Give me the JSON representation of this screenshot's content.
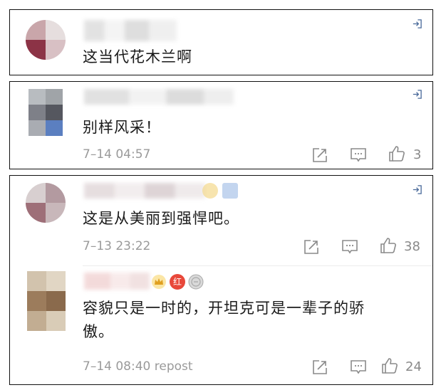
{
  "comments": [
    {
      "text": "这当代花木兰啊",
      "timestamp": ""
    },
    {
      "text": "别样风采！",
      "timestamp": "7–14 04:57",
      "likes": "3"
    },
    {
      "text": "这是从美丽到强悍吧。",
      "timestamp": "7–13 23:22",
      "likes": "38"
    },
    {
      "text": "容貌只是一时的，开坦克可是一辈子的骄傲。",
      "timestamp": "7–14 08:40 repost",
      "likes": "24",
      "badges": [
        {
          "label": "",
          "color": "#e0a020"
        },
        {
          "label": "红",
          "color": "#e8483a"
        },
        {
          "label": "",
          "color": "#a8a8a8"
        }
      ]
    }
  ],
  "icons": {
    "reply": "reply-corner-icon",
    "share": "share-icon",
    "comment": "comment-icon",
    "like": "thumbs-up-icon"
  },
  "colors": {
    "text": "#1a1a1a",
    "meta": "#9a9a9a",
    "icon": "#8a8a8a",
    "border": "#111111"
  }
}
